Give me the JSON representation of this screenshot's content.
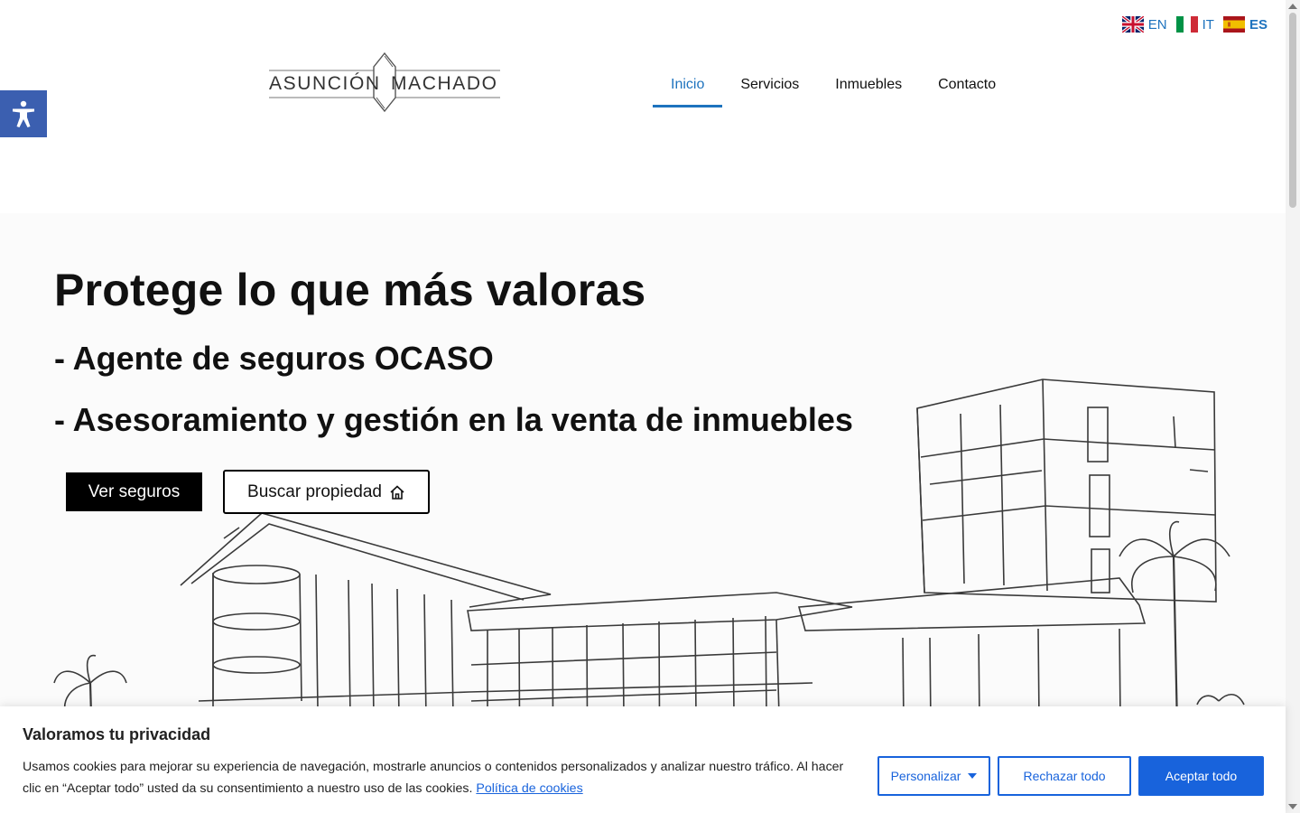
{
  "languages": [
    {
      "code": "EN",
      "active": false
    },
    {
      "code": "IT",
      "active": false
    },
    {
      "code": "ES",
      "active": true
    }
  ],
  "logo": {
    "left": "ASUNCIÓN",
    "right": "MACHADO"
  },
  "nav": [
    {
      "label": "Inicio",
      "active": true
    },
    {
      "label": "Servicios",
      "active": false
    },
    {
      "label": "Inmuebles",
      "active": false
    },
    {
      "label": "Contacto",
      "active": false
    }
  ],
  "hero": {
    "title": "Protege lo que más valoras",
    "subtitle1": "- Agente de seguros OCASO",
    "subtitle2": "- Asesoramiento y gestión en la venta de inmuebles",
    "primary_button": "Ver seguros",
    "secondary_button": "Buscar propiedad"
  },
  "cookie": {
    "title": "Valoramos tu privacidad",
    "text": "Usamos cookies para mejorar su experiencia de navegación, mostrarle anuncios o contenidos personalizados y analizar nuestro tráfico. Al hacer clic en “Aceptar todo” usted da su consentimiento a nuestro uso de las cookies.",
    "link": "Política de cookies",
    "customize": "Personalizar",
    "reject": "Rechazar todo",
    "accept": "Aceptar todo"
  },
  "colors": {
    "accent": "#1e73be",
    "cookie_blue": "#1863dc",
    "a11y_blue": "#3b5fb0"
  },
  "icons": {
    "accessibility": "accessibility-person-icon",
    "home": "home-icon"
  }
}
